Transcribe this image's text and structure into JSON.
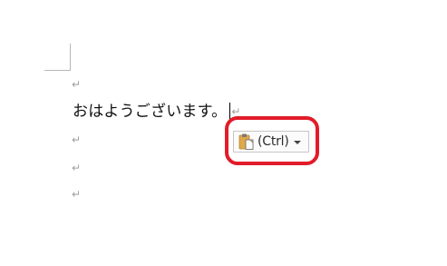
{
  "document": {
    "paragraph_mark": "↵",
    "line_text": "おはようございます。",
    "paste_options": {
      "label": "(Ctrl)",
      "icon": "clipboard-paste-icon",
      "dropdown_icon": "caret-down-icon"
    }
  },
  "colors": {
    "highlight_ring": "#e21c2a",
    "paragraph_mark": "#a0a0a0",
    "clipboard_body": "#e0a84a",
    "clipboard_clip": "#7a7a7a"
  }
}
